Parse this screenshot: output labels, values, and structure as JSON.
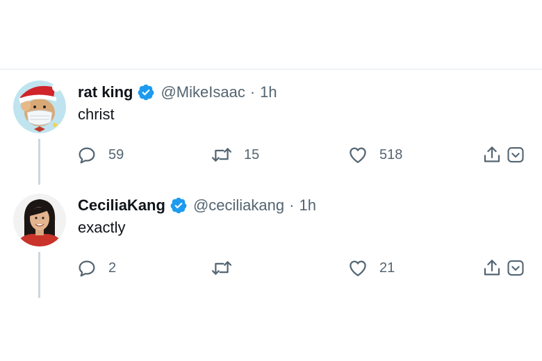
{
  "tweets": [
    {
      "display_name": "rat king",
      "handle": "@MikeIsaac",
      "separator": "·",
      "time": "1h",
      "text": "christ",
      "replies": "59",
      "retweets": "15",
      "likes": "518",
      "verified": true,
      "avatar": "santa-hat-masked-rat-avatar"
    },
    {
      "display_name": "CeciliaKang",
      "handle": "@ceciliakang",
      "separator": "·",
      "time": "1h",
      "text": "exactly",
      "replies": "2",
      "retweets": "",
      "likes": "21",
      "verified": true,
      "avatar": "woman-portrait-avatar"
    }
  ],
  "icons": {
    "reply": "reply-icon",
    "retweet": "retweet-icon",
    "like": "heart-icon",
    "share": "share-icon",
    "more": "chevron-down-icon",
    "verified": "verified-badge-icon"
  },
  "colors": {
    "verified_blue": "#1d9bf0",
    "text_primary": "#0f1419",
    "text_secondary": "#536471",
    "thread_line": "#ccd6dd",
    "divider": "#e1e8ed"
  }
}
